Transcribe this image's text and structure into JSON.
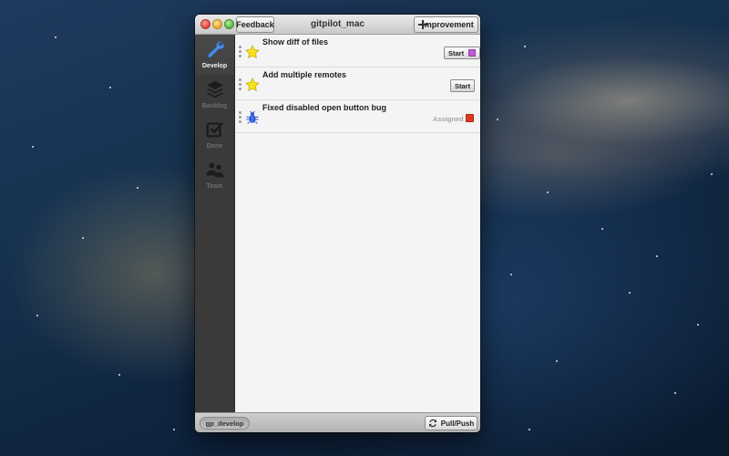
{
  "window": {
    "title": "gitpilot_mac",
    "feedback_label": "Feedback",
    "improvement_label": "Improvement"
  },
  "sidebar": {
    "items": [
      {
        "label": "Develop",
        "icon": "wrench-icon",
        "active": true
      },
      {
        "label": "Backlog",
        "icon": "layers-icon",
        "active": false
      },
      {
        "label": "Done",
        "icon": "checkbox-icon",
        "active": false
      },
      {
        "label": "Team",
        "icon": "people-icon",
        "active": false
      }
    ]
  },
  "tasks": [
    {
      "title": "Show diff of files",
      "icon": "star-icon",
      "action": "Start",
      "status": "",
      "color": "#c05ad6"
    },
    {
      "title": "Add multiple remotes",
      "icon": "star-icon",
      "action": "Start",
      "status": "",
      "color": ""
    },
    {
      "title": "Fixed disabled open button bug",
      "icon": "bug-icon",
      "action": "",
      "status": "Assigned",
      "color": "#e03a1e"
    }
  ],
  "footer": {
    "branch": "gp_develop",
    "pull_push_label": "Pull/Push"
  },
  "colors": {
    "star": "#f5e21b",
    "bug": "#2f57d8"
  }
}
